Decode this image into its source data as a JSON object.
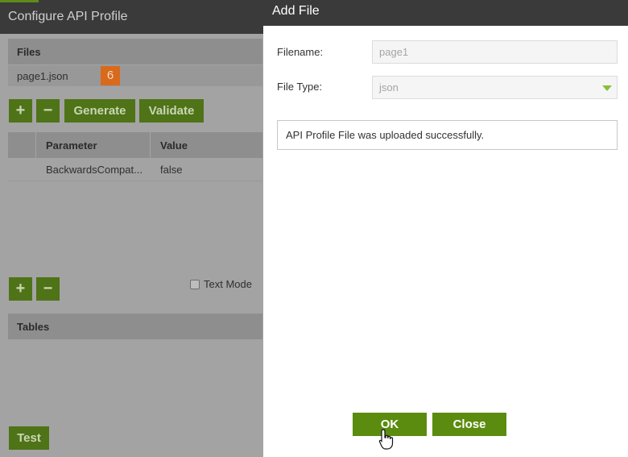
{
  "left_panel": {
    "title": "Configure API Profile",
    "files_section": "Files",
    "file_name": "page1.json",
    "step_badge": "6",
    "add_icon_1": "+",
    "remove_icon_1": "−",
    "generate_label": "Generate",
    "validate_label": "Validate",
    "grid": {
      "headers": [
        "Parameter",
        "Value"
      ],
      "rows": [
        {
          "parameter": "BackwardsCompat...",
          "value": "false"
        }
      ]
    },
    "add_icon_2": "+",
    "remove_icon_2": "−",
    "text_mode_label": "Text Mode",
    "tables_section": "Tables",
    "test_label": "Test"
  },
  "dialog": {
    "title": "Add File",
    "filename_label": "Filename:",
    "filename_value": "page1",
    "filetype_label": "File Type:",
    "filetype_value": "json",
    "message": "API Profile File was uploaded successfully.",
    "ok_label": "OK",
    "close_label": "Close"
  },
  "colors": {
    "accent_green": "#5b8c0f",
    "badge_orange": "#d96a1c",
    "header_dark": "#3a3a3a"
  }
}
